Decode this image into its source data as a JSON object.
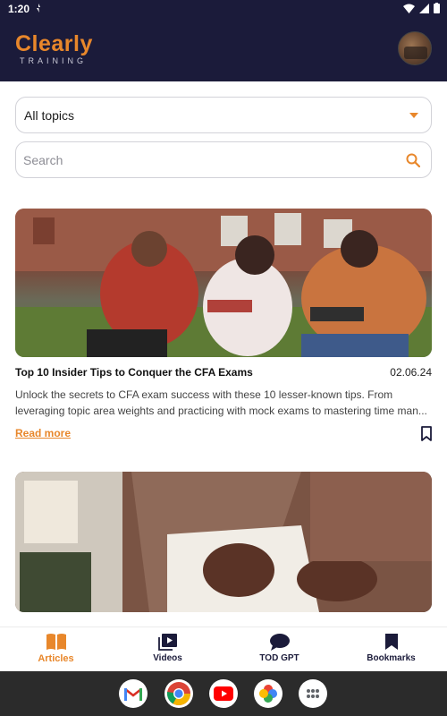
{
  "status_bar": {
    "time": "1:20"
  },
  "header": {
    "brand_name": "Clearly",
    "brand_sub": "TRAINING"
  },
  "filter": {
    "selected": "All topics"
  },
  "search": {
    "placeholder": "Search"
  },
  "articles": [
    {
      "title": "Top 10 Insider Tips to Conquer the CFA Exams",
      "date": "02.06.24",
      "excerpt": "Unlock the secrets to CFA exam success with these 10 lesser-known tips. From leveraging topic area weights and practicing with mock exams to mastering time man...",
      "read_more": "Read more",
      "image_icon": "photo-students-studying"
    },
    {
      "image_icon": "photo-person-reading-papers"
    }
  ],
  "bottom_nav": [
    {
      "label": "Articles",
      "icon": "book-open-icon",
      "active": true
    },
    {
      "label": "Videos",
      "icon": "video-library-icon",
      "active": false
    },
    {
      "label": "TOD GPT",
      "icon": "chat-bubble-icon",
      "active": false
    },
    {
      "label": "Bookmarks",
      "icon": "bookmark-icon",
      "active": false
    }
  ],
  "dock": [
    "gmail-icon",
    "chrome-icon",
    "youtube-icon",
    "photos-icon",
    "app-drawer-icon"
  ],
  "colors": {
    "accent": "#e8872b",
    "navy": "#1b1b3a"
  }
}
